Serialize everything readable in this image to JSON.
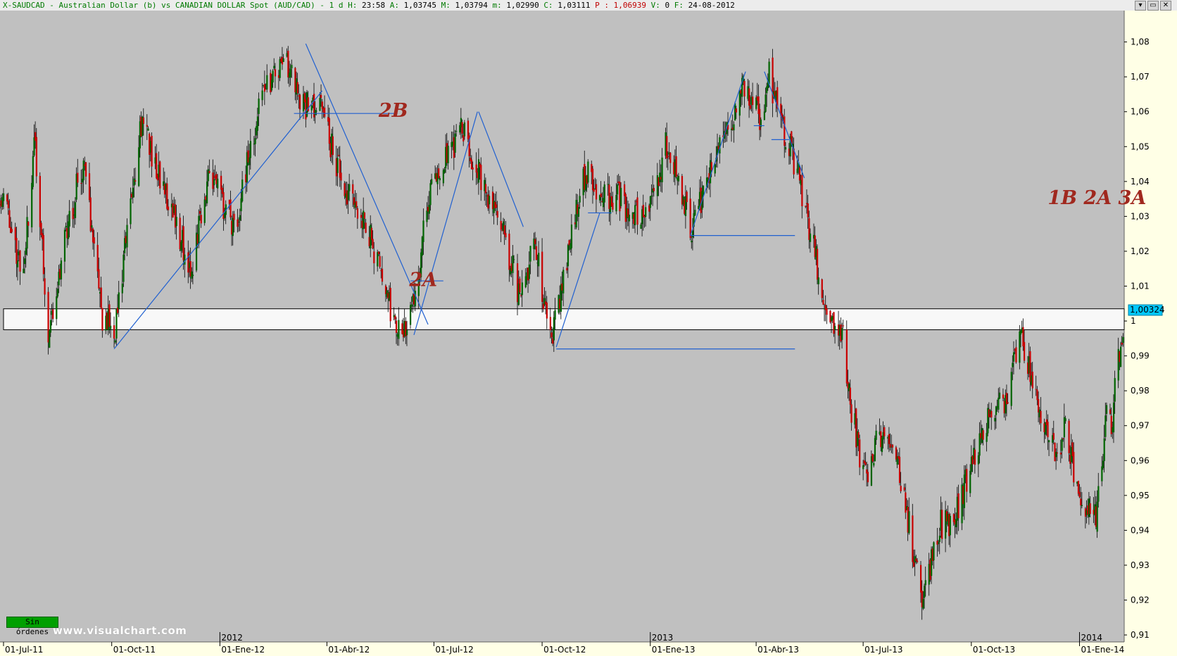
{
  "header": {
    "symbol": "X-SAUDCAD",
    "description": "Australian Dollar (b) vs CANADIAN DOLLAR Spot (AUD/CAD)",
    "period": "1 d",
    "h_label": "H:",
    "time": "23:58",
    "a_label": "A:",
    "open": "1,03745",
    "m_label": "M:",
    "high": "1,03794",
    "low_label": "m:",
    "low": "1,02990",
    "c_label": "C:",
    "close": "1,03111",
    "p_label": "P :",
    "p_value": "1,06939",
    "v_label": "V:",
    "volume": "0",
    "f_label": "F:",
    "date": "24-08-2012"
  },
  "window_buttons": [
    "▾",
    "▭",
    "✕"
  ],
  "price_tag": "1,00324",
  "orders_badge": "Sin órdenes",
  "watermark": "www.visualchart.com",
  "colors": {
    "background": "#c0c0c0",
    "axis_panel": "#ffffe6",
    "bull_candle": "#006400",
    "bear_candle": "#c80000",
    "trendline": "#2060d0",
    "annotation": "#a0281e",
    "zone_fill": "#f8f8f8",
    "price_tag_bg": "#00c8ff"
  },
  "annotations": [
    {
      "text": "2B",
      "x": "2012-05-15",
      "y": 1.0585
    },
    {
      "text": "2A",
      "x": "2012-06-10",
      "y": 1.01
    },
    {
      "text": "1B 2A 3A",
      "x": "2013-12-05",
      "y": 1.0335
    }
  ],
  "chart_data": {
    "type": "candlestick",
    "title": "",
    "x_start": "2011-06-28",
    "x_end": "2014-02-08",
    "ylim": [
      0.908,
      1.089
    ],
    "y_ticks": [
      1.08,
      1.07,
      1.06,
      1.05,
      1.04,
      1.03,
      1.02,
      1.01,
      1.0,
      0.99,
      0.98,
      0.97,
      0.96,
      0.95,
      0.94,
      0.93,
      0.92,
      0.91
    ],
    "y_tick_labels": [
      "1,08",
      "1,07",
      "1,06",
      "1,05",
      "1,04",
      "1,03",
      "1,02",
      "1,01",
      "1",
      "0,99",
      "0,98",
      "0,97",
      "0,96",
      "0,95",
      "0,94",
      "0,93",
      "0,92",
      "0,91"
    ],
    "x_ticks": [
      {
        "date": "2011-07-01",
        "label": "01-Jul-11"
      },
      {
        "date": "2011-10-01",
        "label": "01-Oct-11"
      },
      {
        "date": "2012-01-01",
        "label": "01-Ene-12"
      },
      {
        "date": "2012-04-01",
        "label": "01-Abr-12"
      },
      {
        "date": "2012-07-01",
        "label": "01-Jul-12"
      },
      {
        "date": "2012-10-01",
        "label": "01-Oct-12"
      },
      {
        "date": "2013-01-01",
        "label": "01-Ene-13"
      },
      {
        "date": "2013-04-01",
        "label": "01-Abr-13"
      },
      {
        "date": "2013-07-01",
        "label": "01-Jul-13"
      },
      {
        "date": "2013-10-01",
        "label": "01-Oct-13"
      },
      {
        "date": "2014-01-01",
        "label": "01-Ene-14"
      }
    ],
    "year_ticks": [
      {
        "date": "2012-01-01",
        "label": "2012"
      },
      {
        "date": "2013-01-01",
        "label": "2013"
      },
      {
        "date": "2014-01-01",
        "label": "2014"
      }
    ],
    "close_path": [
      [
        "2011-06-28",
        1.038
      ],
      [
        "2011-07-07",
        1.028
      ],
      [
        "2011-07-18",
        1.012
      ],
      [
        "2011-07-27",
        1.052
      ],
      [
        "2011-08-08",
        0.996
      ],
      [
        "2011-08-25",
        1.028
      ],
      [
        "2011-09-07",
        1.046
      ],
      [
        "2011-09-22",
        1.002
      ],
      [
        "2011-10-04",
        0.998
      ],
      [
        "2011-10-27",
        1.06
      ],
      [
        "2011-11-08",
        1.043
      ],
      [
        "2011-11-23",
        1.031
      ],
      [
        "2011-12-07",
        1.014
      ],
      [
        "2011-12-23",
        1.043
      ],
      [
        "2012-01-13",
        1.026
      ],
      [
        "2012-01-25",
        1.046
      ],
      [
        "2012-02-08",
        1.068
      ],
      [
        "2012-02-28",
        1.074
      ],
      [
        "2012-03-12",
        1.062
      ],
      [
        "2012-03-26",
        1.062
      ],
      [
        "2012-04-04",
        1.051
      ],
      [
        "2012-04-17",
        1.036
      ],
      [
        "2012-05-03",
        1.03
      ],
      [
        "2012-05-22",
        1.006
      ],
      [
        "2012-06-01",
        0.998
      ],
      [
        "2012-06-11",
        1.001
      ],
      [
        "2012-06-29",
        1.04
      ],
      [
        "2012-07-10",
        1.045
      ],
      [
        "2012-07-25",
        1.055
      ],
      [
        "2012-08-09",
        1.041
      ],
      [
        "2012-08-24",
        1.031
      ],
      [
        "2012-09-12",
        1.007
      ],
      [
        "2012-09-25",
        1.022
      ],
      [
        "2012-10-02",
        1.006
      ],
      [
        "2012-10-10",
        0.997
      ],
      [
        "2012-10-30",
        1.033
      ],
      [
        "2012-11-07",
        1.043
      ],
      [
        "2012-11-21",
        1.037
      ],
      [
        "2012-12-05",
        1.036
      ],
      [
        "2012-12-18",
        1.029
      ],
      [
        "2013-01-03",
        1.036
      ],
      [
        "2013-01-15",
        1.051
      ],
      [
        "2013-01-29",
        1.034
      ],
      [
        "2013-02-05",
        1.026
      ],
      [
        "2013-02-26",
        1.048
      ],
      [
        "2013-03-12",
        1.057
      ],
      [
        "2013-03-19",
        1.069
      ],
      [
        "2013-03-28",
        1.063
      ],
      [
        "2013-04-04",
        1.057
      ],
      [
        "2013-04-12",
        1.07
      ],
      [
        "2013-04-26",
        1.053
      ],
      [
        "2013-05-08",
        1.04
      ],
      [
        "2013-05-20",
        1.021
      ],
      [
        "2013-05-31",
        1.0
      ],
      [
        "2013-06-14",
        0.995
      ],
      [
        "2013-06-21",
        0.975
      ],
      [
        "2013-07-02",
        0.955
      ],
      [
        "2013-07-15",
        0.968
      ],
      [
        "2013-07-31",
        0.958
      ],
      [
        "2013-08-09",
        0.941
      ],
      [
        "2013-08-20",
        0.92
      ],
      [
        "2013-09-05",
        0.942
      ],
      [
        "2013-09-16",
        0.942
      ],
      [
        "2013-10-02",
        0.961
      ],
      [
        "2013-10-14",
        0.971
      ],
      [
        "2013-10-30",
        0.978
      ],
      [
        "2013-11-12",
        0.995
      ],
      [
        "2013-11-20",
        0.985
      ],
      [
        "2013-11-28",
        0.976
      ],
      [
        "2013-12-11",
        0.961
      ],
      [
        "2013-12-20",
        0.969
      ],
      [
        "2013-12-31",
        0.948
      ],
      [
        "2014-01-15",
        0.944
      ],
      [
        "2014-01-21",
        0.96
      ],
      [
        "2014-01-24",
        0.98
      ],
      [
        "2014-01-28",
        0.97
      ],
      [
        "2014-02-03",
        0.99
      ],
      [
        "2014-02-08",
        1.002
      ]
    ],
    "zone": {
      "x_from": "2011-07-01",
      "x_to": "2014-02-08",
      "y_low": 0.9975,
      "y_high": 1.0035
    },
    "trendlines": [
      {
        "from": [
          "2011-10-03",
          0.992
        ],
        "to": [
          "2012-03-28",
          1.066
        ]
      },
      {
        "from": [
          "2012-03-04",
          1.0595
        ],
        "to": [
          "2012-05-31",
          1.0595
        ]
      },
      {
        "from": [
          "2012-03-14",
          1.0795
        ],
        "to": [
          "2012-06-26",
          0.999
        ]
      },
      {
        "from": [
          "2012-06-14",
          0.996
        ],
        "to": [
          "2012-08-07",
          1.06
        ]
      },
      {
        "from": [
          "2012-06-11",
          1.0115
        ],
        "to": [
          "2012-07-09",
          1.0115
        ]
      },
      {
        "from": [
          "2012-08-08",
          1.06
        ],
        "to": [
          "2012-09-15",
          1.027
        ]
      },
      {
        "from": [
          "2012-10-13",
          0.9925
        ],
        "to": [
          "2012-11-19",
          1.031
        ]
      },
      {
        "from": [
          "2012-11-09",
          1.031
        ],
        "to": [
          "2012-11-29",
          1.031
        ]
      },
      {
        "from": [
          "2012-10-13",
          0.992
        ],
        "to": [
          "2013-05-04",
          0.992
        ]
      },
      {
        "from": [
          "2013-02-04",
          1.0245
        ],
        "to": [
          "2013-03-23",
          1.0715
        ]
      },
      {
        "from": [
          "2013-02-04",
          1.0245
        ],
        "to": [
          "2013-05-04",
          1.0245
        ]
      },
      {
        "from": [
          "2013-04-08",
          1.0715
        ],
        "to": [
          "2013-05-12",
          1.041
        ]
      },
      {
        "from": [
          "2013-03-30",
          1.056
        ],
        "to": [
          "2013-04-08",
          1.056
        ]
      },
      {
        "from": [
          "2013-04-14",
          1.052
        ],
        "to": [
          "2013-04-29",
          1.052
        ]
      }
    ]
  }
}
